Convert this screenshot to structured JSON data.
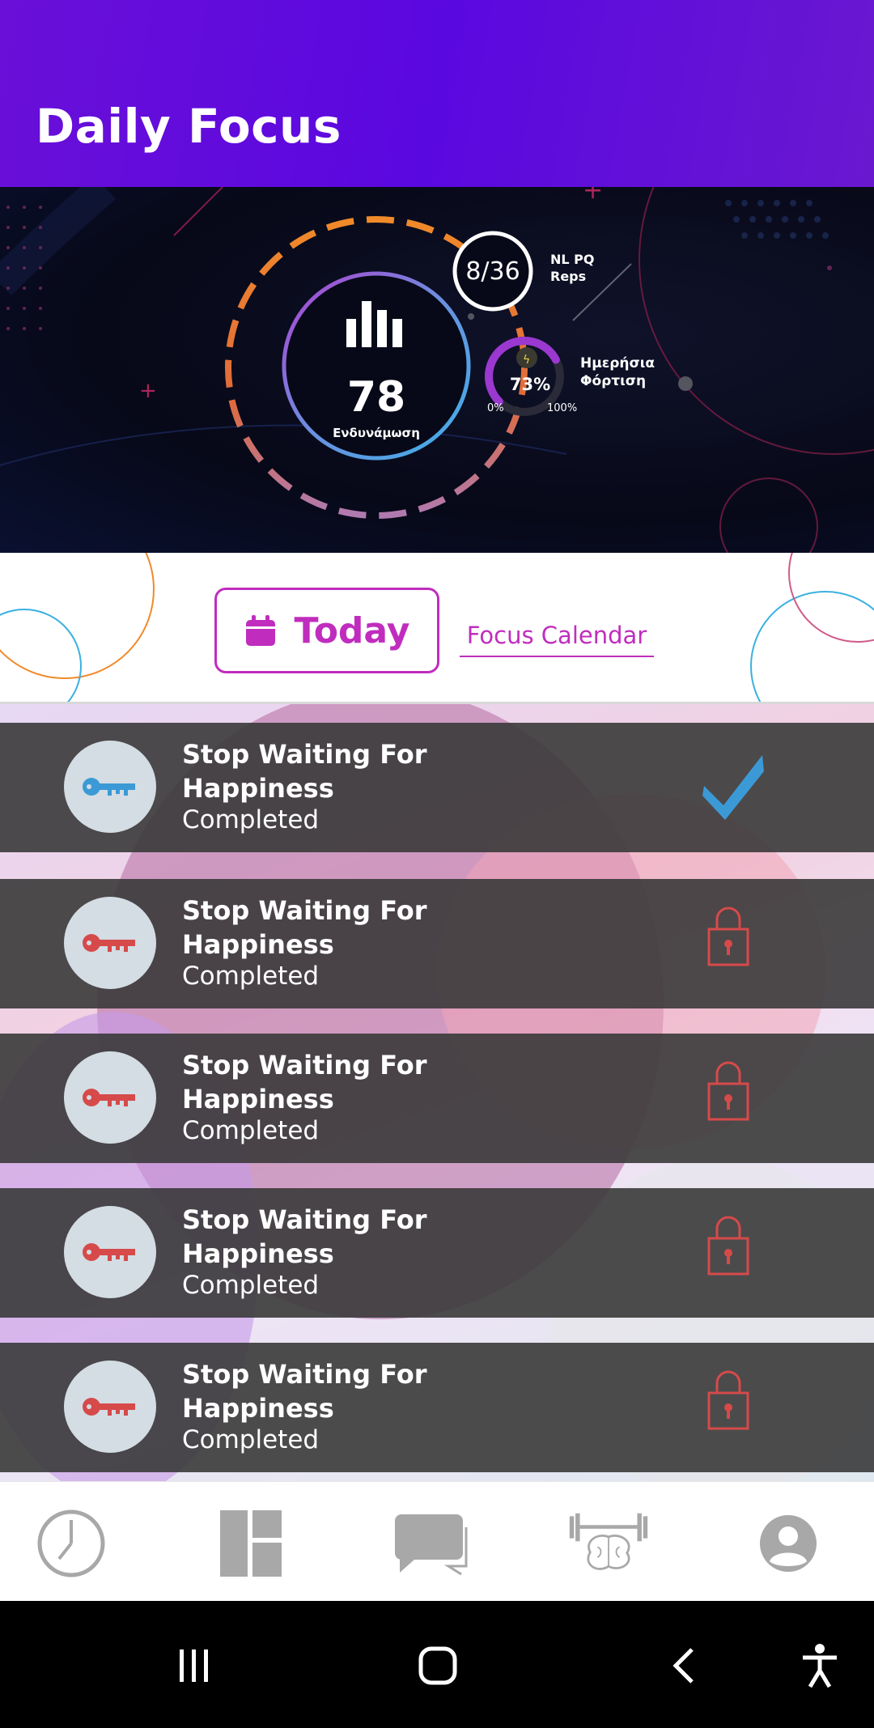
{
  "header": {
    "title": "Daily Focus"
  },
  "hero": {
    "score_value": "78",
    "score_label": "Ενδυνάμωση",
    "reps_value": "8/36",
    "reps_label_line1": "NL PQ",
    "reps_label_line2": "Reps",
    "load_value": "73%",
    "load_min": "0%",
    "load_max": "100%",
    "load_label_line1": "Ημερήσια",
    "load_label_line2": "Φόρτιση",
    "load_fraction": 0.73
  },
  "filters": {
    "today_label": "Today",
    "calendar_label": "Focus Calendar"
  },
  "items": [
    {
      "title": "Stop Waiting For Happiness",
      "status": "Completed",
      "key_color": "#3b9ad6",
      "state": "completed"
    },
    {
      "title": "Stop Waiting For Happiness",
      "status": "Completed",
      "key_color": "#d64a4a",
      "state": "locked"
    },
    {
      "title": "Stop Waiting For Happiness",
      "status": "Completed",
      "key_color": "#d64a4a",
      "state": "locked"
    },
    {
      "title": "Stop Waiting For Happiness",
      "status": "Completed",
      "key_color": "#d64a4a",
      "state": "locked"
    },
    {
      "title": "Stop Waiting For Happiness",
      "status": "Completed",
      "key_color": "#d64a4a",
      "state": "locked"
    }
  ],
  "nav": [
    {
      "icon": "clock-icon"
    },
    {
      "icon": "dashboard-icon"
    },
    {
      "icon": "chat-icon"
    },
    {
      "icon": "brain-training-icon"
    },
    {
      "icon": "profile-icon"
    }
  ],
  "system_nav": [
    {
      "icon": "recent-apps-icon"
    },
    {
      "icon": "home-icon"
    },
    {
      "icon": "back-icon"
    },
    {
      "icon": "accessibility-icon"
    }
  ],
  "colors": {
    "accent": "#c02dbe",
    "header_bg": "#5a08e0",
    "check": "#3b9ad6",
    "lock": "#d64a4a"
  }
}
